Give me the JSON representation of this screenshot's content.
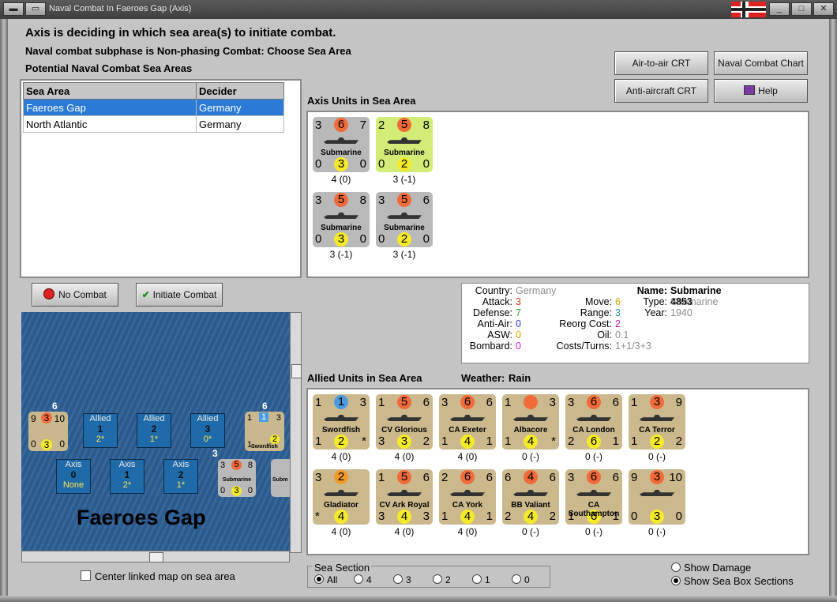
{
  "window": {
    "title": "Naval Combat In Faeroes Gap (Axis)"
  },
  "header": {
    "status": "Axis is deciding in which sea area(s) to initiate combat.",
    "subphase": "Naval combat subphase is Non-phasing Combat: Choose Sea Area",
    "list_title": "Potential Naval Combat Sea Areas"
  },
  "buttons": {
    "air_to_air": "Air-to-air CRT",
    "naval_chart": "Naval Combat Chart",
    "anti_aircraft": "Anti-aircraft CRT",
    "help": "Help",
    "no_combat": "No Combat",
    "initiate": "Initiate Combat"
  },
  "table": {
    "headers": [
      "Sea Area",
      "Decider"
    ],
    "rows": [
      {
        "area": "Faeroes Gap",
        "decider": "Germany",
        "selected": true
      },
      {
        "area": "North Atlantic",
        "decider": "Germany",
        "selected": false
      }
    ]
  },
  "axis_panel": {
    "title": "Axis Units in Sea Area",
    "units": [
      {
        "tl": "3",
        "tm": "6",
        "tr": "7",
        "name": "Submarine",
        "bl": "0",
        "bm": "3",
        "br": "0",
        "caption": "4 (0)",
        "bg": "#b9b9b9"
      },
      {
        "tl": "2",
        "tm": "5",
        "tr": "8",
        "name": "Submarine",
        "bl": "0",
        "bm": "2",
        "br": "0",
        "caption": "3 (-1)",
        "bg": "#d3ec78"
      },
      {
        "tl": "3",
        "tm": "5",
        "tr": "8",
        "name": "Submarine",
        "bl": "0",
        "bm": "3",
        "br": "0",
        "caption": "3 (-1)",
        "bg": "#b9b9b9"
      },
      {
        "tl": "3",
        "tm": "5",
        "tr": "6",
        "name": "Submarine",
        "bl": "0",
        "bm": "2",
        "br": "0",
        "caption": "3 (-1)",
        "bg": "#b9b9b9"
      }
    ]
  },
  "details": {
    "country_k": "Country:",
    "country_v": "Germany",
    "attack_k": "Attack:",
    "attack_v": "3",
    "defense_k": "Defense:",
    "defense_v": "7",
    "antiair_k": "Anti-Air:",
    "antiair_v": "0",
    "asw_k": "ASW:",
    "asw_v": "0",
    "bombard_k": "Bombard:",
    "bombard_v": "0",
    "move_k": "Move:",
    "move_v": "6",
    "range_k": "Range:",
    "range_v": "3",
    "reorg_k": "Reorg Cost:",
    "reorg_v": "2",
    "oil_k": "Oil:",
    "oil_v": "0.1",
    "costs_k": "Costs/Turns:",
    "costs_v": "1+1/3+3",
    "name_k": "Name:",
    "name_v": "Submarine 4853",
    "type_k": "Type:",
    "type_v": "Submarine",
    "year_k": "Year:",
    "year_v": "1940"
  },
  "allied_panel": {
    "title": "Allied Units in Sea Area",
    "weather_label": "Weather:",
    "weather": "Rain",
    "units": [
      {
        "tl": "1",
        "tm": "1",
        "tr": "3",
        "name": "Swordfish",
        "bl": "1",
        "bm": "2",
        "br": "*",
        "caption": "4 (0)",
        "tmc": "#4a9be0"
      },
      {
        "tl": "1",
        "tm": "5",
        "tr": "6",
        "name": "CV Glorious",
        "bl": "3",
        "bm": "3",
        "br": "2",
        "caption": "4 (0)",
        "tmc": "#f06a3a"
      },
      {
        "tl": "3",
        "tm": "6",
        "tr": "6",
        "name": "CA Exeter",
        "bl": "1",
        "bm": "4",
        "br": "1",
        "caption": "4 (0)",
        "tmc": "#f06a3a"
      },
      {
        "tl": "1",
        "tm": "",
        "tr": "3",
        "name": "Albacore",
        "bl": "1",
        "bm": "4",
        "br": "*",
        "caption": "0 (-)",
        "tmc": "#f06a3a"
      },
      {
        "tl": "3",
        "tm": "6",
        "tr": "6",
        "name": "CA London",
        "bl": "2",
        "bm": "6",
        "br": "1",
        "caption": "0 (-)",
        "tmc": "#f06a3a"
      },
      {
        "tl": "1",
        "tm": "3",
        "tr": "9",
        "name": "CA Terror",
        "bl": "1",
        "bm": "2",
        "br": "2",
        "caption": "0 (-)",
        "tmc": "#f06a3a"
      },
      {
        "tl": "3",
        "tm": "2",
        "tr": "",
        "name": "Gladiator",
        "bl": "*",
        "bm": "4",
        "br": "",
        "caption": "4 (0)",
        "tmc": "#f39a2a"
      },
      {
        "tl": "1",
        "tm": "5",
        "tr": "6",
        "name": "CV Ark Royal",
        "bl": "3",
        "bm": "4",
        "br": "3",
        "caption": "4 (0)",
        "tmc": "#f06a3a"
      },
      {
        "tl": "2",
        "tm": "6",
        "tr": "6",
        "name": "CA York",
        "bl": "1",
        "bm": "4",
        "br": "1",
        "caption": "4 (0)",
        "tmc": "#f06a3a"
      },
      {
        "tl": "6",
        "tm": "4",
        "tr": "6",
        "name": "BB Valiant",
        "bl": "2",
        "bm": "4",
        "br": "2",
        "caption": "0 (-)",
        "tmc": "#f06a3a"
      },
      {
        "tl": "3",
        "tm": "6",
        "tr": "6",
        "name": "CA Southampton",
        "bl": "1",
        "bm": "6",
        "br": "1",
        "caption": "0 (-)",
        "tmc": "#f06a3a"
      },
      {
        "tl": "9",
        "tm": "3",
        "tr": "10",
        "name": "",
        "bl": "0",
        "bm": "3",
        "br": "0",
        "caption": "0 (-)",
        "tmc": "#f06a3a"
      }
    ]
  },
  "map": {
    "name": "Faeroes Gap",
    "allied_boxes": [
      {
        "label": "Allied",
        "num": "1",
        "sub": "2*"
      },
      {
        "label": "Allied",
        "num": "2",
        "sub": "1*"
      },
      {
        "label": "Allied",
        "num": "3",
        "sub": "0*"
      }
    ],
    "axis_boxes": [
      {
        "label": "Axis",
        "num": "0",
        "sub": "None"
      },
      {
        "label": "Axis",
        "num": "1",
        "sub": "2*"
      },
      {
        "label": "Axis",
        "num": "2",
        "sub": "1*"
      }
    ],
    "stack_left": {
      "count": "6",
      "tl": "9",
      "tm": "3",
      "tr": "10",
      "bl": "0",
      "bm": "3",
      "br": "0"
    },
    "stack_right": {
      "count": "6",
      "tl": "1",
      "tm": "1",
      "tr": "3",
      "name": "Swordfish",
      "bl": "1",
      "bm": "2"
    },
    "stack_sub": {
      "count": "3",
      "tl": "3",
      "tm": "5",
      "tr": "8",
      "name": "Submarine",
      "bl": "0",
      "bm": "3",
      "br": "0",
      "extra": "Subm"
    },
    "center_label": "Center linked map on sea area"
  },
  "sea_section": {
    "title": "Sea Section",
    "options": [
      "All",
      "4",
      "3",
      "2",
      "1",
      "0"
    ]
  },
  "toggles": {
    "show_damage": "Show Damage",
    "show_sections": "Show Sea Box Sections"
  }
}
